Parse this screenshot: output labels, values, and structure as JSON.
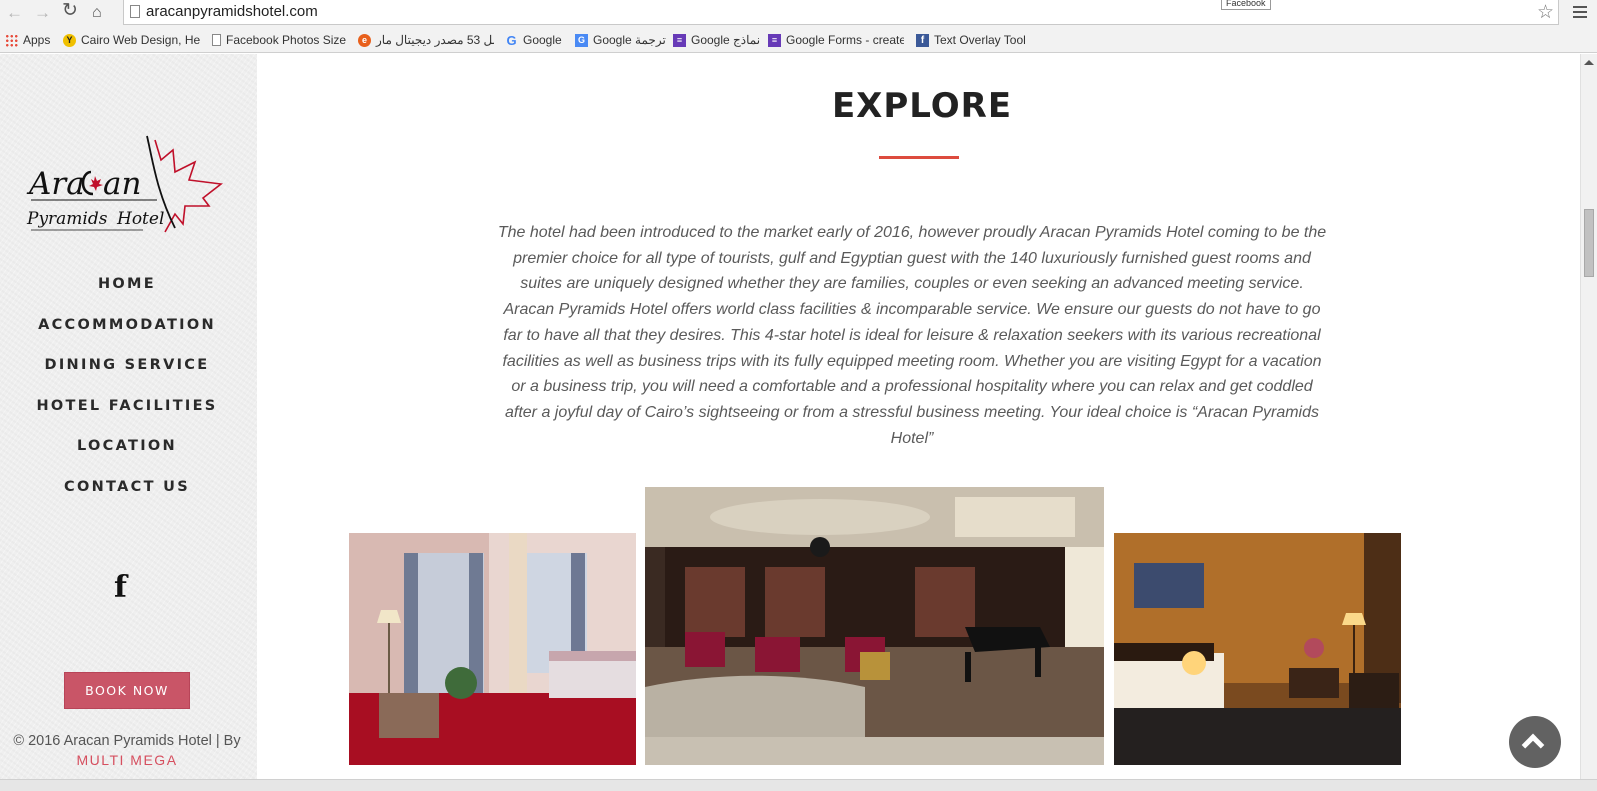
{
  "browser": {
    "url": "aracanpyramidshotel.com",
    "tooltip": "Facebook",
    "bookmarks": [
      {
        "label": "Apps",
        "icon": "apps-grid-icon"
      },
      {
        "label": "Cairo Web Design, He",
        "icon": "yellow-circle-icon"
      },
      {
        "label": "Facebook Photos Size",
        "icon": "page-icon"
      },
      {
        "label": "افضل 53 مصدر ديجيتال مار",
        "icon": "swirl-icon"
      },
      {
        "label": "Google",
        "icon": "google-g-icon"
      },
      {
        "label": "Google ترجمة",
        "icon": "google-translate-icon"
      },
      {
        "label": "Google نماذج",
        "icon": "google-forms-icon"
      },
      {
        "label": "Google Forms - create",
        "icon": "google-forms-icon"
      },
      {
        "label": "Text Overlay Tool",
        "icon": "facebook-icon"
      }
    ]
  },
  "sidebar": {
    "logo": {
      "line1": "AraCan",
      "line2": "Pyramids Hotel"
    },
    "nav": [
      {
        "label": "HOME"
      },
      {
        "label": "ACCOMMODATION"
      },
      {
        "label": "DINING SERVICE"
      },
      {
        "label": "HOTEL FACILITIES"
      },
      {
        "label": "LOCATION"
      },
      {
        "label": "CONTACT US"
      }
    ],
    "social_icon": "f",
    "book_button": "BOOK NOW",
    "copyright": "© 2016 Aracan Pyramids Hotel | By",
    "credit_link": "MULTI MEGA"
  },
  "main": {
    "title": "EXPLORE",
    "intro": "The hotel had been introduced to the market early of 2016, however proudly Aracan Pyramids Hotel coming to be the premier choice for all type of tourists, gulf and Egyptian guest with the 140 luxuriously furnished guest rooms and suites are uniquely designed whether they are families, couples or even seeking an advanced meeting service. Aracan Pyramids Hotel offers world class facilities & incomparable service. We ensure our guests do not have to go far to have all that they desires. This 4-star hotel is ideal for leisure & relaxation seekers with its various recreational facilities as well as business trips with its fully equipped meeting room. Whether you are visiting Egypt for a vacation or a business trip, you will need a comfortable and a professional hospitality where you can relax and get coddled after a joyful day of Cairo’s sightseeing or from a stressful business meeting. Your ideal choice is “Aracan Pyramids Hotel”"
  },
  "colors": {
    "accent": "#dd4b3e",
    "button": "#c95567",
    "credit": "#d64f5f",
    "sidebar_bg": "#efefef"
  }
}
